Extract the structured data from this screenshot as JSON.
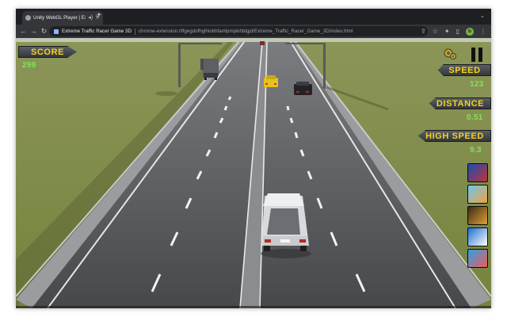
{
  "browser": {
    "tab_title": "Unity WebGL Player | Extre",
    "omnibox": {
      "site_name": "Extreme Traffic Racer Game 3D",
      "url": "chrome-extension://lfgegdofhglhiobhfanlipmpikhblgjd/Extreme_Traffic_Racer_Game_3D/index.html"
    },
    "profile_initial": "b"
  },
  "hud": {
    "score_label": "SCORE",
    "score_value": "299",
    "speed_label": "SPEED",
    "speed_value": "123",
    "distance_label": "DISTANCE",
    "distance_value": "0.51",
    "high_speed_label": "HIGH SPEED",
    "high_speed_value": "9.3"
  },
  "colors": {
    "hud_label_text": "#f6d21a",
    "hud_value_text": "#7fe25a",
    "grass": "#7d8a46",
    "asphalt": "#4b4d50",
    "sky": "#bfc9b4"
  },
  "icons": {
    "back": "arrow-left-icon",
    "forward": "arrow-right-icon",
    "reload": "reload-icon",
    "pause": "pause-icon",
    "settings": "gear-icon"
  }
}
